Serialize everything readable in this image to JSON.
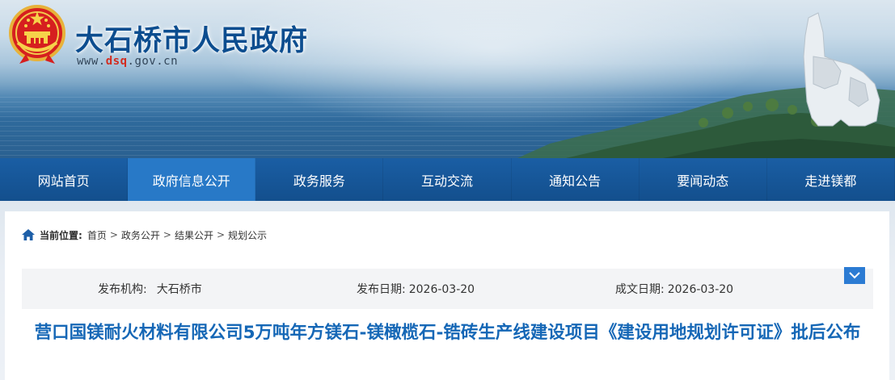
{
  "header": {
    "site_title": "大石桥市人民政府",
    "url_prefix": "www.",
    "url_highlight": "dsq",
    "url_suffix": ".gov.cn",
    "emblem_icon": "national-emblem-icon"
  },
  "nav": {
    "items": [
      {
        "label": "网站首页",
        "active": false
      },
      {
        "label": "政府信息公开",
        "active": true
      },
      {
        "label": "政务服务",
        "active": false
      },
      {
        "label": "互动交流",
        "active": false
      },
      {
        "label": "通知公告",
        "active": false
      },
      {
        "label": "要闻动态",
        "active": false
      },
      {
        "label": "走进镁都",
        "active": false
      }
    ]
  },
  "breadcrumb": {
    "icon": "home-icon",
    "label": "当前位置:",
    "items": [
      "首页",
      "政务公开",
      "结果公开",
      "规划公示"
    ],
    "separator": ">"
  },
  "meta": {
    "publisher_label": "发布机构:",
    "publisher_value": "大石桥市",
    "publish_date_label": "发布日期:",
    "publish_date_value": "2026-03-20",
    "created_date_label": "成文日期:",
    "created_date_value": "2026-03-20",
    "toggle_icon": "chevron-down-icon"
  },
  "article": {
    "title": "营口国镁耐火材料有限公司5万吨年方镁石-镁橄榄石-锆砖生产线建设项目《建设用地规划许可证》批后公布"
  },
  "colors": {
    "brand_blue": "#1567b6",
    "nav_bg": "#1a5ea4",
    "nav_active": "#2879c7",
    "title_blue": "#0c4d8f",
    "url_red": "#d22b1f"
  }
}
